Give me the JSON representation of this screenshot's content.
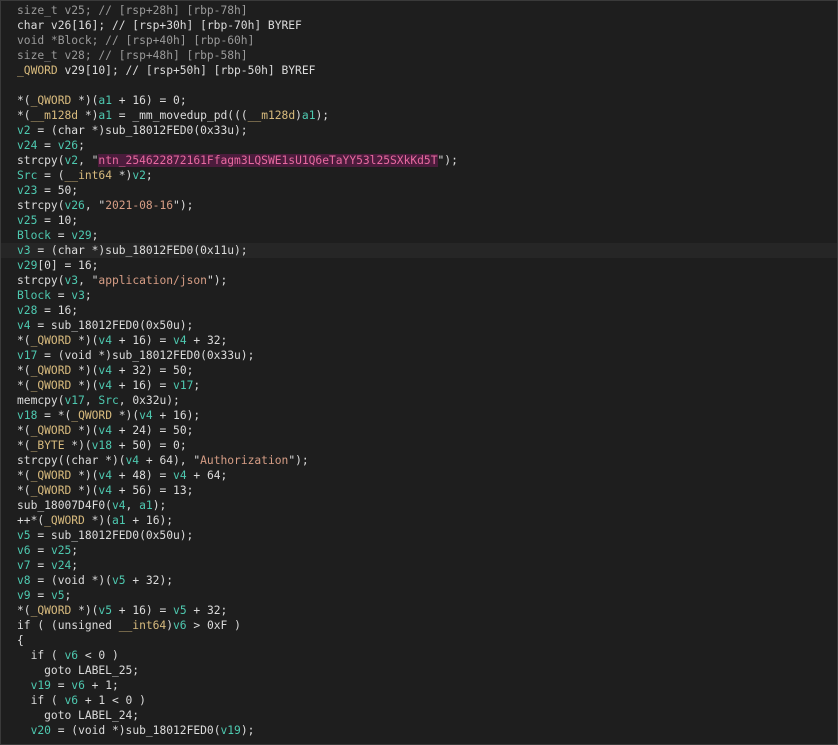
{
  "editor": {
    "lines": [
      {
        "hl": false,
        "tokens": [
          {
            "t": "g",
            "v": "size_t v25; // [rsp+28h] [rbp-78h]"
          }
        ]
      },
      {
        "hl": false,
        "tokens": [
          {
            "t": "p",
            "v": "char v26[16]; // [rsp+30h] [rbp-70h] BYREF"
          }
        ]
      },
      {
        "hl": false,
        "tokens": [
          {
            "t": "g",
            "v": "void *Block; // [rsp+40h] [rbp-60h]"
          }
        ]
      },
      {
        "hl": false,
        "tokens": [
          {
            "t": "g",
            "v": "size_t v28; // [rsp+48h] [rbp-58h]"
          }
        ]
      },
      {
        "hl": false,
        "tokens": [
          {
            "t": "ty",
            "v": "_QWORD"
          },
          {
            "t": "p",
            "v": " v29[10]; // [rsp+50h] [rbp-50h] BYREF"
          }
        ]
      },
      {
        "hl": false,
        "tokens": [
          {
            "t": "p",
            "v": ""
          }
        ]
      },
      {
        "hl": false,
        "tokens": [
          {
            "t": "p",
            "v": "*("
          },
          {
            "t": "ty",
            "v": "_QWORD"
          },
          {
            "t": "p",
            "v": " *)("
          },
          {
            "t": "v",
            "v": "a1"
          },
          {
            "t": "p",
            "v": " + 16) = 0;"
          }
        ]
      },
      {
        "hl": false,
        "tokens": [
          {
            "t": "p",
            "v": "*("
          },
          {
            "t": "ty",
            "v": "__m128d"
          },
          {
            "t": "p",
            "v": " *)"
          },
          {
            "t": "v",
            "v": "a1"
          },
          {
            "t": "p",
            "v": " = _mm_movedup_pd((("
          },
          {
            "t": "ty",
            "v": "__m128d"
          },
          {
            "t": "p",
            "v": ")"
          },
          {
            "t": "v",
            "v": "a1"
          },
          {
            "t": "p",
            "v": ");"
          }
        ]
      },
      {
        "hl": false,
        "tokens": [
          {
            "t": "v",
            "v": "v2"
          },
          {
            "t": "p",
            "v": " = (char *)sub_18012FED0(0x33u);"
          }
        ]
      },
      {
        "hl": false,
        "tokens": [
          {
            "t": "v",
            "v": "v24"
          },
          {
            "t": "p",
            "v": " = "
          },
          {
            "t": "v",
            "v": "v26"
          },
          {
            "t": "p",
            "v": ";"
          }
        ]
      },
      {
        "hl": false,
        "tokens": [
          {
            "t": "p",
            "v": "strcpy("
          },
          {
            "t": "v",
            "v": "v2"
          },
          {
            "t": "p",
            "v": ", \""
          },
          {
            "t": "sel",
            "v": "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"
          },
          {
            "t": "p",
            "v": "\");"
          }
        ]
      },
      {
        "hl": false,
        "tokens": [
          {
            "t": "v",
            "v": "Src"
          },
          {
            "t": "p",
            "v": " = ("
          },
          {
            "t": "ty",
            "v": "__int64"
          },
          {
            "t": "p",
            "v": " *)"
          },
          {
            "t": "v",
            "v": "v2"
          },
          {
            "t": "p",
            "v": ";"
          }
        ]
      },
      {
        "hl": false,
        "tokens": [
          {
            "t": "v",
            "v": "v23"
          },
          {
            "t": "p",
            "v": " = 50;"
          }
        ]
      },
      {
        "hl": false,
        "tokens": [
          {
            "t": "p",
            "v": "strcpy("
          },
          {
            "t": "v",
            "v": "v26"
          },
          {
            "t": "p",
            "v": ", \""
          },
          {
            "t": "s",
            "v": "2021-08-16"
          },
          {
            "t": "p",
            "v": "\");"
          }
        ]
      },
      {
        "hl": false,
        "tokens": [
          {
            "t": "v",
            "v": "v25"
          },
          {
            "t": "p",
            "v": " = 10;"
          }
        ]
      },
      {
        "hl": false,
        "tokens": [
          {
            "t": "v",
            "v": "Block"
          },
          {
            "t": "p",
            "v": " = "
          },
          {
            "t": "v",
            "v": "v29"
          },
          {
            "t": "p",
            "v": ";"
          }
        ]
      },
      {
        "hl": true,
        "tokens": [
          {
            "t": "v",
            "v": "v3"
          },
          {
            "t": "p",
            "v": " = (char *)sub_18012FED0(0x11u);"
          }
        ]
      },
      {
        "hl": false,
        "tokens": [
          {
            "t": "v",
            "v": "v29"
          },
          {
            "t": "p",
            "v": "[0] = 16;"
          }
        ]
      },
      {
        "hl": false,
        "tokens": [
          {
            "t": "p",
            "v": "strcpy("
          },
          {
            "t": "v",
            "v": "v3"
          },
          {
            "t": "p",
            "v": ", \""
          },
          {
            "t": "s",
            "v": "application/json"
          },
          {
            "t": "p",
            "v": "\");"
          }
        ]
      },
      {
        "hl": false,
        "tokens": [
          {
            "t": "v",
            "v": "Block"
          },
          {
            "t": "p",
            "v": " = "
          },
          {
            "t": "v",
            "v": "v3"
          },
          {
            "t": "p",
            "v": ";"
          }
        ]
      },
      {
        "hl": false,
        "tokens": [
          {
            "t": "v",
            "v": "v28"
          },
          {
            "t": "p",
            "v": " = 16;"
          }
        ]
      },
      {
        "hl": false,
        "tokens": [
          {
            "t": "v",
            "v": "v4"
          },
          {
            "t": "p",
            "v": " = sub_18012FED0(0x50u);"
          }
        ]
      },
      {
        "hl": false,
        "tokens": [
          {
            "t": "p",
            "v": "*("
          },
          {
            "t": "ty",
            "v": "_QWORD"
          },
          {
            "t": "p",
            "v": " *)("
          },
          {
            "t": "v",
            "v": "v4"
          },
          {
            "t": "p",
            "v": " + 16) = "
          },
          {
            "t": "v",
            "v": "v4"
          },
          {
            "t": "p",
            "v": " + 32;"
          }
        ]
      },
      {
        "hl": false,
        "tokens": [
          {
            "t": "v",
            "v": "v17"
          },
          {
            "t": "p",
            "v": " = (void *)sub_18012FED0(0x33u);"
          }
        ]
      },
      {
        "hl": false,
        "tokens": [
          {
            "t": "p",
            "v": "*("
          },
          {
            "t": "ty",
            "v": "_QWORD"
          },
          {
            "t": "p",
            "v": " *)("
          },
          {
            "t": "v",
            "v": "v4"
          },
          {
            "t": "p",
            "v": " + 32) = 50;"
          }
        ]
      },
      {
        "hl": false,
        "tokens": [
          {
            "t": "p",
            "v": "*("
          },
          {
            "t": "ty",
            "v": "_QWORD"
          },
          {
            "t": "p",
            "v": " *)("
          },
          {
            "t": "v",
            "v": "v4"
          },
          {
            "t": "p",
            "v": " + 16) = "
          },
          {
            "t": "v",
            "v": "v17"
          },
          {
            "t": "p",
            "v": ";"
          }
        ]
      },
      {
        "hl": false,
        "tokens": [
          {
            "t": "p",
            "v": "memcpy("
          },
          {
            "t": "v",
            "v": "v17"
          },
          {
            "t": "p",
            "v": ", "
          },
          {
            "t": "v",
            "v": "Src"
          },
          {
            "t": "p",
            "v": ", 0x32u);"
          }
        ]
      },
      {
        "hl": false,
        "tokens": [
          {
            "t": "v",
            "v": "v18"
          },
          {
            "t": "p",
            "v": " = *("
          },
          {
            "t": "ty",
            "v": "_QWORD"
          },
          {
            "t": "p",
            "v": " *)("
          },
          {
            "t": "v",
            "v": "v4"
          },
          {
            "t": "p",
            "v": " + 16);"
          }
        ]
      },
      {
        "hl": false,
        "tokens": [
          {
            "t": "p",
            "v": "*("
          },
          {
            "t": "ty",
            "v": "_QWORD"
          },
          {
            "t": "p",
            "v": " *)("
          },
          {
            "t": "v",
            "v": "v4"
          },
          {
            "t": "p",
            "v": " + 24) = 50;"
          }
        ]
      },
      {
        "hl": false,
        "tokens": [
          {
            "t": "p",
            "v": "*("
          },
          {
            "t": "ty",
            "v": "_BYTE"
          },
          {
            "t": "p",
            "v": " *)("
          },
          {
            "t": "v",
            "v": "v18"
          },
          {
            "t": "p",
            "v": " + 50) = 0;"
          }
        ]
      },
      {
        "hl": false,
        "tokens": [
          {
            "t": "p",
            "v": "strcpy((char *)("
          },
          {
            "t": "v",
            "v": "v4"
          },
          {
            "t": "p",
            "v": " + 64), \""
          },
          {
            "t": "s",
            "v": "Authorization"
          },
          {
            "t": "p",
            "v": "\");"
          }
        ]
      },
      {
        "hl": false,
        "tokens": [
          {
            "t": "p",
            "v": "*("
          },
          {
            "t": "ty",
            "v": "_QWORD"
          },
          {
            "t": "p",
            "v": " *)("
          },
          {
            "t": "v",
            "v": "v4"
          },
          {
            "t": "p",
            "v": " + 48) = "
          },
          {
            "t": "v",
            "v": "v4"
          },
          {
            "t": "p",
            "v": " + 64;"
          }
        ]
      },
      {
        "hl": false,
        "tokens": [
          {
            "t": "p",
            "v": "*("
          },
          {
            "t": "ty",
            "v": "_QWORD"
          },
          {
            "t": "p",
            "v": " *)("
          },
          {
            "t": "v",
            "v": "v4"
          },
          {
            "t": "p",
            "v": " + 56) = 13;"
          }
        ]
      },
      {
        "hl": false,
        "tokens": [
          {
            "t": "p",
            "v": "sub_18007D4F0("
          },
          {
            "t": "v",
            "v": "v4"
          },
          {
            "t": "p",
            "v": ", "
          },
          {
            "t": "v",
            "v": "a1"
          },
          {
            "t": "p",
            "v": ");"
          }
        ]
      },
      {
        "hl": false,
        "tokens": [
          {
            "t": "p",
            "v": "++*("
          },
          {
            "t": "ty",
            "v": "_QWORD"
          },
          {
            "t": "p",
            "v": " *)("
          },
          {
            "t": "v",
            "v": "a1"
          },
          {
            "t": "p",
            "v": " + 16);"
          }
        ]
      },
      {
        "hl": false,
        "tokens": [
          {
            "t": "v",
            "v": "v5"
          },
          {
            "t": "p",
            "v": " = sub_18012FED0(0x50u);"
          }
        ]
      },
      {
        "hl": false,
        "tokens": [
          {
            "t": "v",
            "v": "v6"
          },
          {
            "t": "p",
            "v": " = "
          },
          {
            "t": "v",
            "v": "v25"
          },
          {
            "t": "p",
            "v": ";"
          }
        ]
      },
      {
        "hl": false,
        "tokens": [
          {
            "t": "v",
            "v": "v7"
          },
          {
            "t": "p",
            "v": " = "
          },
          {
            "t": "v",
            "v": "v24"
          },
          {
            "t": "p",
            "v": ";"
          }
        ]
      },
      {
        "hl": false,
        "tokens": [
          {
            "t": "v",
            "v": "v8"
          },
          {
            "t": "p",
            "v": " = (void *)("
          },
          {
            "t": "v",
            "v": "v5"
          },
          {
            "t": "p",
            "v": " + 32);"
          }
        ]
      },
      {
        "hl": false,
        "tokens": [
          {
            "t": "v",
            "v": "v9"
          },
          {
            "t": "p",
            "v": " = "
          },
          {
            "t": "v",
            "v": "v5"
          },
          {
            "t": "p",
            "v": ";"
          }
        ]
      },
      {
        "hl": false,
        "tokens": [
          {
            "t": "p",
            "v": "*("
          },
          {
            "t": "ty",
            "v": "_QWORD"
          },
          {
            "t": "p",
            "v": " *)("
          },
          {
            "t": "v",
            "v": "v5"
          },
          {
            "t": "p",
            "v": " + 16) = "
          },
          {
            "t": "v",
            "v": "v5"
          },
          {
            "t": "p",
            "v": " + 32;"
          }
        ]
      },
      {
        "hl": false,
        "tokens": [
          {
            "t": "p",
            "v": "if ( (unsigned "
          },
          {
            "t": "ty",
            "v": "__int64"
          },
          {
            "t": "p",
            "v": ")"
          },
          {
            "t": "v",
            "v": "v6"
          },
          {
            "t": "p",
            "v": " > 0xF )"
          }
        ]
      },
      {
        "hl": false,
        "tokens": [
          {
            "t": "p",
            "v": "{"
          }
        ]
      },
      {
        "hl": false,
        "tokens": [
          {
            "t": "p",
            "v": "  if ( "
          },
          {
            "t": "v",
            "v": "v6"
          },
          {
            "t": "p",
            "v": " < 0 )"
          }
        ]
      },
      {
        "hl": false,
        "tokens": [
          {
            "t": "p",
            "v": "    goto LABEL_25;"
          }
        ]
      },
      {
        "hl": false,
        "tokens": [
          {
            "t": "p",
            "v": "  "
          },
          {
            "t": "v",
            "v": "v19"
          },
          {
            "t": "p",
            "v": " = "
          },
          {
            "t": "v",
            "v": "v6"
          },
          {
            "t": "p",
            "v": " + 1;"
          }
        ]
      },
      {
        "hl": false,
        "tokens": [
          {
            "t": "p",
            "v": "  if ( "
          },
          {
            "t": "v",
            "v": "v6"
          },
          {
            "t": "p",
            "v": " + 1 < 0 )"
          }
        ]
      },
      {
        "hl": false,
        "tokens": [
          {
            "t": "p",
            "v": "    goto LABEL_24;"
          }
        ]
      },
      {
        "hl": false,
        "tokens": [
          {
            "t": "p",
            "v": "  "
          },
          {
            "t": "v",
            "v": "v20"
          },
          {
            "t": "p",
            "v": " = (void *)sub_18012FED0("
          },
          {
            "t": "v",
            "v": "v19"
          },
          {
            "t": "p",
            "v": ");"
          }
        ]
      }
    ]
  }
}
